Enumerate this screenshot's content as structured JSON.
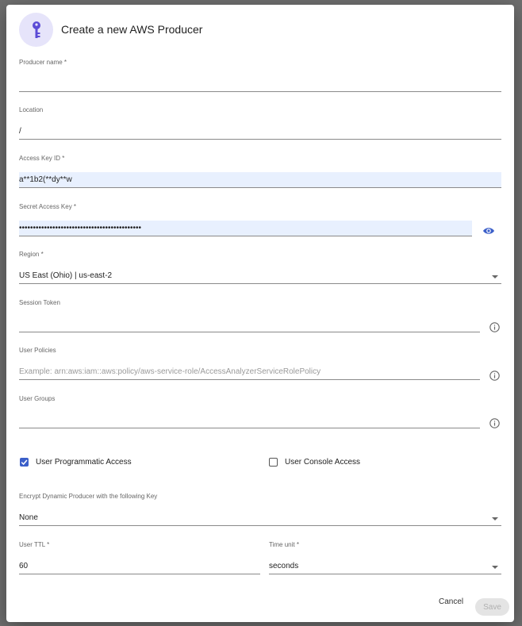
{
  "dialog": {
    "title": "Create a new AWS Producer",
    "icon": "key-icon"
  },
  "fields": {
    "producer_name": {
      "label": "Producer name *",
      "value": ""
    },
    "location": {
      "label": "Location",
      "value": "/"
    },
    "access_key_id": {
      "label": "Access Key ID *",
      "value": "a**1b2(**dy**w"
    },
    "secret_access_key": {
      "label": "Secret Access Key *",
      "value": "••••••••••••••••••••••••••••••••••••••••••••",
      "icon": "eye-icon"
    },
    "region": {
      "label": "Region *",
      "value": "US East (Ohio) | us-east-2"
    },
    "session_token": {
      "label": "Session Token",
      "value": ""
    },
    "user_policies": {
      "label": "User Policies",
      "placeholder": "Example: arn:aws:iam::aws:policy/aws-service-role/AccessAnalyzerServiceRolePolicy"
    },
    "user_groups": {
      "label": "User Groups",
      "value": ""
    },
    "encrypt_key": {
      "label": "Encrypt Dynamic Producer with the following Key",
      "value": "None"
    },
    "user_ttl": {
      "label": "User TTL *",
      "value": "60"
    },
    "time_unit": {
      "label": "Time unit *",
      "value": "seconds"
    }
  },
  "checkboxes": {
    "programmatic": {
      "label": "User Programmatic Access",
      "checked": true
    },
    "console": {
      "label": "User Console Access",
      "checked": false
    }
  },
  "buttons": {
    "cancel": "Cancel",
    "save": "Save"
  },
  "colors": {
    "accent": "#3b5fc9",
    "key_icon": "#5b4bd6",
    "autofill_bg": "#e8f0fe",
    "avatar_bg": "#e6e4fa"
  }
}
